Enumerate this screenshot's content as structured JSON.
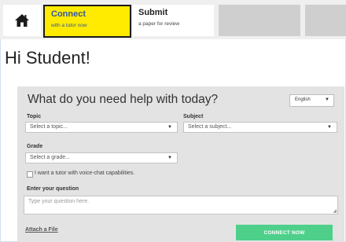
{
  "nav": {
    "home_icon": "home-icon",
    "tabs": [
      {
        "title": "Connect",
        "subtitle": "with a tutor now"
      },
      {
        "title": "Submit",
        "subtitle": "a paper for review"
      }
    ]
  },
  "greeting": "Hi Student!",
  "form": {
    "title": "What do you need help with today?",
    "language": "English",
    "topic_label": "Topic",
    "topic_value": "Select a topic...",
    "subject_label": "Subject",
    "subject_value": "Select a subject...",
    "grade_label": "Grade",
    "grade_value": "Select a grade...",
    "voice_chat_label": "I want a tutor with voice-chat capabilities.",
    "question_label": "Enter your question",
    "question_placeholder": "Type your question here.",
    "attach_label": "Attach a File",
    "submit_label": "CONNECT NOW"
  },
  "colors": {
    "active_tab": "#ffeb00",
    "active_tab_text": "#3355aa",
    "button": "#4ed08b",
    "panel": "#e3e3e3"
  }
}
